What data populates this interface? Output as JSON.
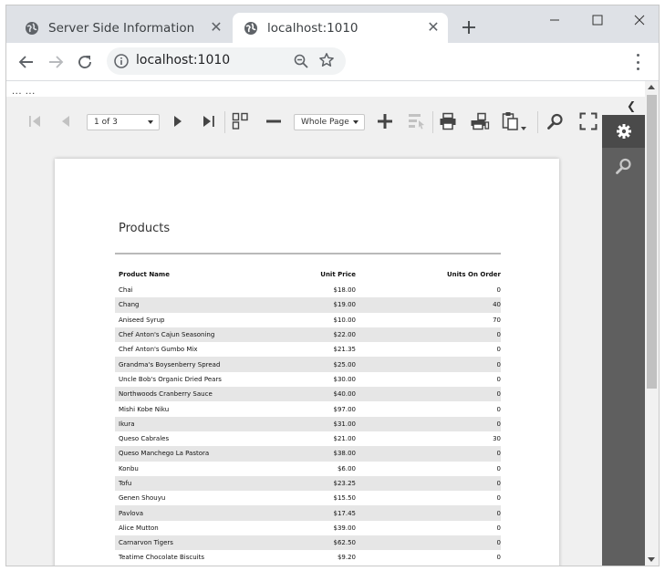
{
  "browser": {
    "tabs": [
      {
        "title": "Server Side Information"
      },
      {
        "title": "localhost:1010"
      }
    ],
    "address": "localhost:1010"
  },
  "content": {
    "ellipsis": "... ..."
  },
  "viewer": {
    "page_indicator": "1 of 3",
    "zoom_mode": "Whole Page"
  },
  "report": {
    "title": "Products",
    "columns": [
      "Product Name",
      "Unit Price",
      "Units On Order"
    ],
    "rows": [
      [
        "Chai",
        "$18.00",
        "0"
      ],
      [
        "Chang",
        "$19.00",
        "40"
      ],
      [
        "Aniseed Syrup",
        "$10.00",
        "70"
      ],
      [
        "Chef Anton's Cajun Seasoning",
        "$22.00",
        "0"
      ],
      [
        "Chef Anton's Gumbo Mix",
        "$21.35",
        "0"
      ],
      [
        "Grandma's Boysenberry Spread",
        "$25.00",
        "0"
      ],
      [
        "Uncle Bob's Organic Dried Pears",
        "$30.00",
        "0"
      ],
      [
        "Northwoods Cranberry Sauce",
        "$40.00",
        "0"
      ],
      [
        "Mishi Kobe Niku",
        "$97.00",
        "0"
      ],
      [
        "Ikura",
        "$31.00",
        "0"
      ],
      [
        "Queso Cabrales",
        "$21.00",
        "30"
      ],
      [
        "Queso Manchego La Pastora",
        "$38.00",
        "0"
      ],
      [
        "Konbu",
        "$6.00",
        "0"
      ],
      [
        "Tofu",
        "$23.25",
        "0"
      ],
      [
        "Genen Shouyu",
        "$15.50",
        "0"
      ],
      [
        "Pavlova",
        "$17.45",
        "0"
      ],
      [
        "Alice Mutton",
        "$39.00",
        "0"
      ],
      [
        "Carnarvon Tigers",
        "$62.50",
        "0"
      ],
      [
        "Teatime Chocolate Biscuits",
        "$9.20",
        "0"
      ]
    ]
  }
}
